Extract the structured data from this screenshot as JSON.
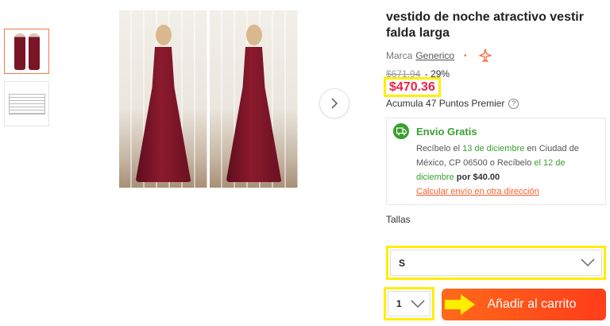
{
  "gallery": {
    "thumbnails": [
      {
        "icon": "dress-thumbnail-icon",
        "active": true
      },
      {
        "icon": "size-chart-thumbnail-icon",
        "active": false
      }
    ],
    "next_icon": "chevron-right-icon"
  },
  "product": {
    "title": "vestido de noche atractivo vestir falda larga",
    "brand_label": "Marca",
    "brand_name": "Generico",
    "seller_icon": "plane-icon",
    "old_price": "$671.94",
    "discount": "- 29%",
    "price": "$470.36",
    "points": "Acumula 47 Puntos Premier",
    "help_icon": "question-icon"
  },
  "shipping": {
    "icon": "truck-icon",
    "title": "Envio Gratis",
    "line_prefix": "Recíbelo el ",
    "date1": "13 de diciembre",
    "line_mid": " en Ciudad de México, CP 06500 o Recíbelo ",
    "date2": "el 12 de diciembre",
    "price_label": "por $40.00",
    "link": "Calcular envío en otra dirección"
  },
  "sizes": {
    "label": "Tallas",
    "selected": "S",
    "icon": "chevron-down-icon"
  },
  "quantity": {
    "selected": "1",
    "icon": "chevron-down-icon"
  },
  "cart": {
    "label": "Añadir al carrito"
  },
  "colors": {
    "price_red": "#ee2244",
    "shipping_green": "#3aa02e",
    "cart_orange": "#ff5a1a",
    "highlight_yellow": "#ffee00"
  }
}
